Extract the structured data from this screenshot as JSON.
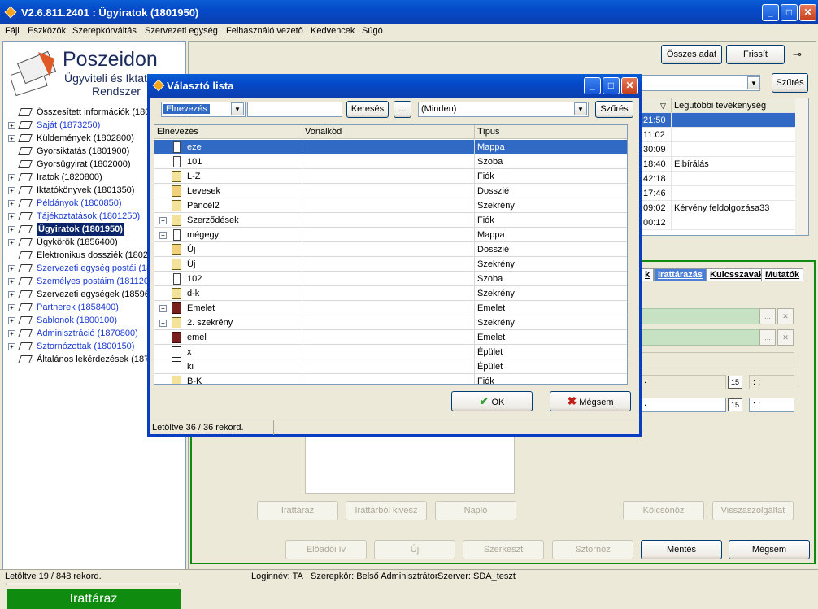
{
  "window": {
    "title": "V2.6.811.2401 : Ügyiratok (1801950)",
    "min": "_",
    "max": "□",
    "close": "✕"
  },
  "menu": [
    "Fájl",
    "Eszközök",
    "Szerepkörváltás",
    "Szervezeti egység",
    "Felhasználó vezető",
    "Kedvencek",
    "Súgó"
  ],
  "logo": {
    "name": "Poszeidon",
    "line1": "Ügyviteli és Iktató",
    "line2": "Rendszer"
  },
  "tree": [
    {
      "label": "Összesített információk (1801",
      "exp": false,
      "link": false,
      "sel": false
    },
    {
      "label": "Saját (1873250)",
      "exp": true,
      "link": true,
      "sel": false
    },
    {
      "label": "Küldemények (1802800)",
      "exp": true,
      "link": false,
      "sel": false
    },
    {
      "label": "Gyorsiktatás (1801900)",
      "exp": false,
      "link": false,
      "sel": false
    },
    {
      "label": "Gyorsügyirat (1802000)",
      "exp": false,
      "link": false,
      "sel": false
    },
    {
      "label": "Iratok (1820800)",
      "exp": true,
      "link": false,
      "sel": false
    },
    {
      "label": "Iktatókönyvek (1801350)",
      "exp": true,
      "link": false,
      "sel": false
    },
    {
      "label": "Példányok (1800850)",
      "exp": true,
      "link": true,
      "sel": false
    },
    {
      "label": "Tájékoztatások (1801250)",
      "exp": true,
      "link": true,
      "sel": false
    },
    {
      "label": "Ügyiratok (1801950)",
      "exp": true,
      "link": false,
      "sel": true
    },
    {
      "label": "Ügykörök (1856400)",
      "exp": true,
      "link": false,
      "sel": false
    },
    {
      "label": "Elektronikus dossziék (18027",
      "exp": false,
      "link": false,
      "sel": false
    },
    {
      "label": "Szervezeti egység postái (18",
      "exp": true,
      "link": true,
      "sel": false
    },
    {
      "label": "Személyes postáim (1811200",
      "exp": true,
      "link": true,
      "sel": false
    },
    {
      "label": "Szervezeti egységek (18596",
      "exp": true,
      "link": false,
      "sel": false
    },
    {
      "label": "Partnerek (1858400)",
      "exp": true,
      "link": true,
      "sel": false
    },
    {
      "label": "Sablonok (1800100)",
      "exp": true,
      "link": true,
      "sel": false
    },
    {
      "label": "Adminisztráció (1870800)",
      "exp": true,
      "link": true,
      "sel": false
    },
    {
      "label": "Sztornózottak (1800150)",
      "exp": true,
      "link": true,
      "sel": false
    },
    {
      "label": "Általános lekérdezések (1873",
      "exp": false,
      "link": false,
      "sel": false
    }
  ],
  "left_bottom": "Irattáraz",
  "top_buttons": {
    "all": "Összes adat",
    "refresh": "Frissít",
    "filter": "Szűrés"
  },
  "grid": {
    "header_last": "Legutóbbi tevékenység",
    "rows": [
      {
        "t": ":21:50",
        "a": ""
      },
      {
        "t": ":11:02",
        "a": ""
      },
      {
        "t": ":30:09",
        "a": ""
      },
      {
        "t": ":18:40",
        "a": "Elbírálás"
      },
      {
        "t": ":42:18",
        "a": ""
      },
      {
        "t": ":17:46",
        "a": ""
      },
      {
        "t": ":09:02",
        "a": "Kérvény feldolgozása33"
      },
      {
        "t": ":00:12",
        "a": ""
      }
    ]
  },
  "tabs": [
    {
      "label": "k",
      "active": false
    },
    {
      "label": "Irattárazás",
      "active": true
    },
    {
      "label": "Kulcsszavak",
      "active": false
    },
    {
      "label": "Mutatók",
      "active": false
    }
  ],
  "time_placeholder": ": :",
  "date_dot": ".",
  "ellipsis": "...",
  "clear_x": "✕",
  "calendar_day": "15",
  "mid_buttons": {
    "irattaraz": "Irattáraz",
    "kivesz": "Irattárból kivesz",
    "naplo": "Napló",
    "kolcsonoz": "Kölcsönöz",
    "vissza": "Visszaszolgáltat"
  },
  "bottom_buttons": {
    "eloadoi": "Előadói ív",
    "uj": "Új",
    "szerkeszt": "Szerkeszt",
    "sztornoz": "Sztornóz",
    "mentes": "Mentés",
    "megsem": "Mégsem"
  },
  "status": {
    "loaded": "Letöltve 19 / 848 rekord.",
    "login": "Loginnév: TA",
    "role": "Szerepkör: Belső Adminisztrátor",
    "server": "Szerver: SDA_teszt"
  },
  "dialog": {
    "title": "Választó lista",
    "field_select": "Elnevezés",
    "search_btn": "Keresés",
    "dots_btn": "...",
    "type_select": "(Minden)",
    "filter_btn": "Szűrés",
    "columns": [
      "Elnevezés",
      "Vonalkód",
      "Típus"
    ],
    "rows": [
      {
        "name": "eze",
        "code": "",
        "type": "Mappa",
        "icon": "mappa",
        "exp": false,
        "sel": true
      },
      {
        "name": "101",
        "code": "",
        "type": "Szoba",
        "icon": "mappa",
        "exp": false,
        "sel": false
      },
      {
        "name": "L-Z",
        "code": "",
        "type": "Fiók",
        "icon": "fiok",
        "exp": false,
        "sel": false
      },
      {
        "name": "Levesek",
        "code": "",
        "type": "Dosszié",
        "icon": "dosszie",
        "exp": false,
        "sel": false
      },
      {
        "name": "Páncél2",
        "code": "",
        "type": "Szekrény",
        "icon": "szekreny",
        "exp": false,
        "sel": false
      },
      {
        "name": "Szerződések",
        "code": "",
        "type": "Fiók",
        "icon": "fiok",
        "exp": true,
        "sel": false
      },
      {
        "name": "mégegy",
        "code": "",
        "type": "Mappa",
        "icon": "mappa",
        "exp": true,
        "sel": false
      },
      {
        "name": "Új",
        "code": "",
        "type": "Dosszié",
        "icon": "dosszie",
        "exp": false,
        "sel": false
      },
      {
        "name": "Új",
        "code": "",
        "type": "Szekrény",
        "icon": "szekreny",
        "exp": false,
        "sel": false
      },
      {
        "name": "102",
        "code": "",
        "type": "Szoba",
        "icon": "mappa",
        "exp": false,
        "sel": false
      },
      {
        "name": "d-k",
        "code": "",
        "type": "Szekrény",
        "icon": "szekreny",
        "exp": false,
        "sel": false
      },
      {
        "name": "Emelet",
        "code": "",
        "type": "Emelet",
        "icon": "emelet",
        "exp": true,
        "sel": false
      },
      {
        "name": "2. szekrény",
        "code": "",
        "type": "Szekrény",
        "icon": "szekreny",
        "exp": true,
        "sel": false
      },
      {
        "name": "emel",
        "code": "",
        "type": "Emelet",
        "icon": "emelet",
        "exp": false,
        "sel": false
      },
      {
        "name": "x",
        "code": "",
        "type": "Épület",
        "icon": "epulet",
        "exp": false,
        "sel": false
      },
      {
        "name": "ki",
        "code": "",
        "type": "Épület",
        "icon": "epulet",
        "exp": false,
        "sel": false
      },
      {
        "name": "B-K",
        "code": "",
        "type": "Fiók",
        "icon": "fiok",
        "exp": false,
        "sel": false
      }
    ],
    "ok": "OK",
    "cancel": "Mégsem",
    "status": "Letöltve 36 / 36 rekord."
  }
}
